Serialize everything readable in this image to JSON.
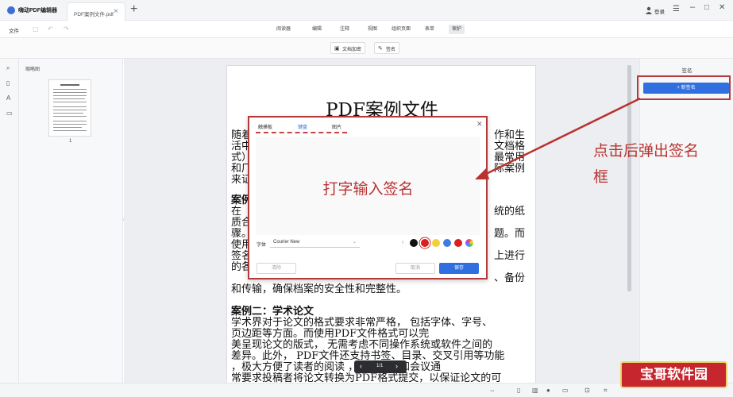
{
  "window": {
    "app_name": "嗨动PDF编辑器",
    "doc_tab": "PDF案例文件.pdf",
    "login": "登录"
  },
  "toolbar": {
    "file_menu": "文件",
    "tabs": [
      "阅读器",
      "编辑",
      "注释",
      "视图",
      "组织页面",
      "表单",
      "保护"
    ],
    "active_tab": "保护"
  },
  "subtoolbar": {
    "encrypt": "文档加密",
    "sign": "签名"
  },
  "thumbnails": {
    "title": "缩略图",
    "page_number": "1"
  },
  "document": {
    "title": "PDF案例文件",
    "lines_left": [
      "随着",
      "活中",
      "式）",
      "和厂",
      "来证"
    ],
    "lines_right": [
      "作和生",
      "文档格",
      "最常用",
      "际案例"
    ],
    "section1_heading": "案例",
    "section1_left": [
      "在",
      "质合",
      "骤。",
      "使用",
      "签名",
      "的各"
    ],
    "section1_right": [
      "统的纸",
      "题。而",
      "上进行",
      "、备份"
    ],
    "section1_last": "和传输，确保档案的安全性和完整性。",
    "section2_heading": "案例二：学术论文",
    "section2_lines": [
      "学术界对于论文的格式要求非常严格， 包括字体、字号、",
      "页边距等方面。而使用PDF文件格式可以完",
      "美呈现论文的版式， 无需考虑不同操作系统或软件之间的",
      "差异。此外， PDF文件还支持书签、目录、交叉引用等功能",
      "，极大方便了读者的阅读 ，学术期刊和会议通",
      "常要求投稿者将论文转换为PDF格式提交，以保证论文的可"
    ]
  },
  "dialog": {
    "tabs": [
      "触摸板",
      "键盘",
      "图片"
    ],
    "active_tab": "键盘",
    "hint": "打字输入签名",
    "font_label": "字体",
    "font_value": "Courier New",
    "colors": [
      "#111111",
      "#d91f1f",
      "#f2d035",
      "#3f7be0",
      "#d91f1f"
    ],
    "clear": "清除",
    "cancel": "取消",
    "save": "保存"
  },
  "annotation": {
    "line1": "点击后弹出签名",
    "line2": "框",
    "color": "#b8332f"
  },
  "right_panel": {
    "title": "签名",
    "new_signature": "+ 新签名"
  },
  "page_nav": {
    "label": "1/1"
  },
  "watermark": "宝哥软件园"
}
